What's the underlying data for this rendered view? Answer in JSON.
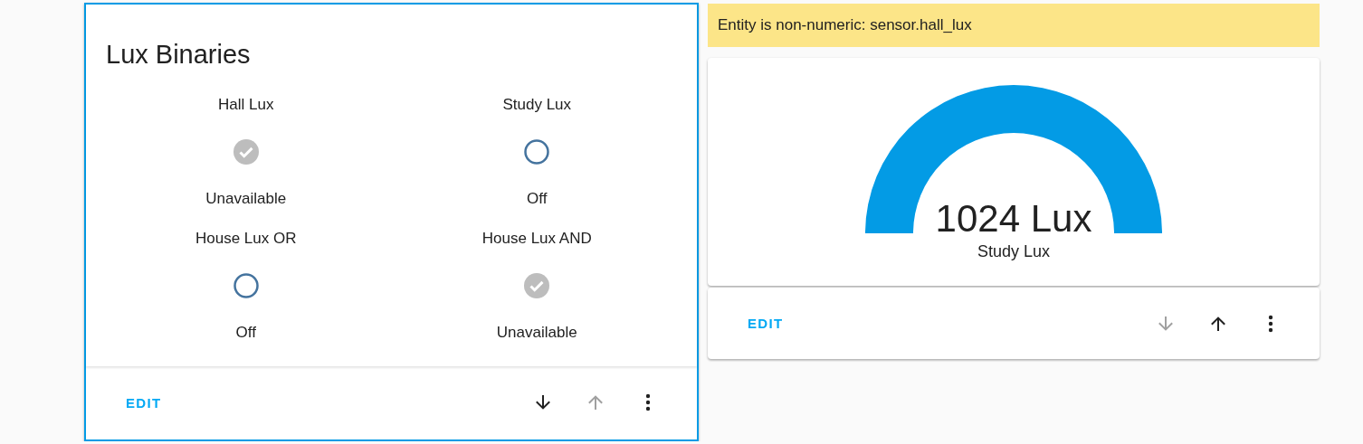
{
  "left_card": {
    "selected": true,
    "title": "Lux Binaries",
    "entities": [
      {
        "name": "Hall Lux",
        "kind": "unavailable",
        "state": "Unavailable"
      },
      {
        "name": "Study Lux",
        "kind": "off",
        "state": "Off"
      },
      {
        "name": "House Lux OR",
        "kind": "off",
        "state": "Off"
      },
      {
        "name": "House Lux AND",
        "kind": "unavailable",
        "state": "Unavailable"
      }
    ],
    "footer": {
      "edit": "EDIT",
      "move_down_disabled": false,
      "move_up_disabled": true
    }
  },
  "right_column": {
    "warning": "Entity is non-numeric: sensor.hall_lux",
    "gauge": {
      "value": "1024 Lux",
      "name": "Study Lux"
    },
    "footer": {
      "edit": "EDIT",
      "move_down_disabled": true,
      "move_up_disabled": false
    }
  }
}
